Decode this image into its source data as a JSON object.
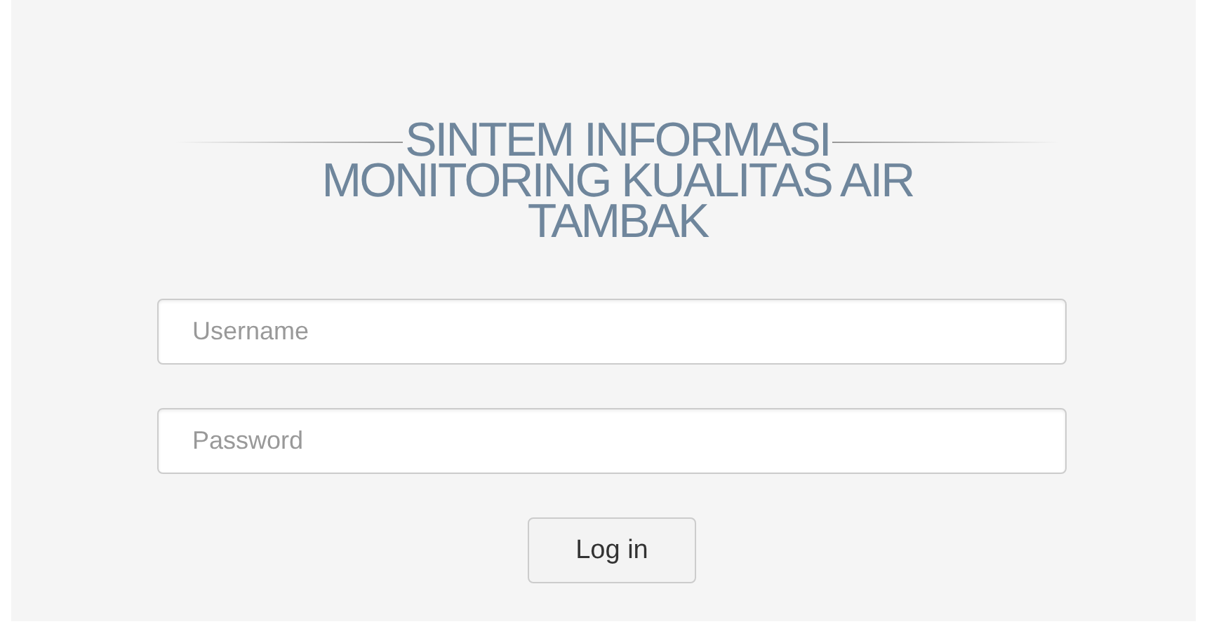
{
  "title": [
    "SINTEM INFORMASI",
    "MONITORING KUALITAS AIR",
    "TAMBAK"
  ],
  "fields": [
    {
      "placeholder": "Username"
    },
    {
      "placeholder": "Password"
    }
  ],
  "button": "Log in"
}
